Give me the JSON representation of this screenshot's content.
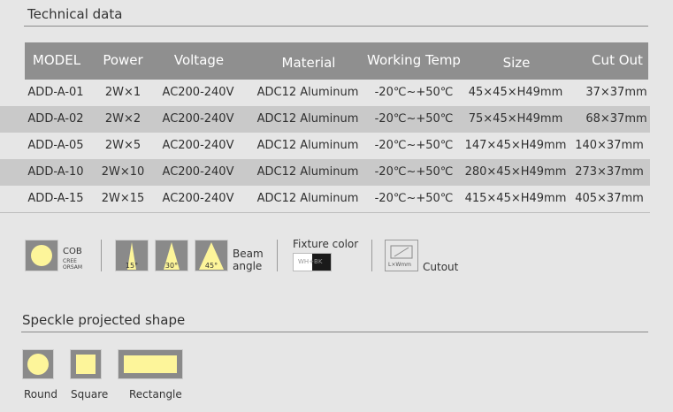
{
  "technical_title": "Technical data",
  "table": {
    "headers": [
      "MODEL",
      "Power",
      "Voltage",
      "Material",
      "Working Temp",
      "Size",
      "Cut Out"
    ],
    "rows": [
      [
        "ADD-A-01",
        "2W×1",
        "AC200-240V",
        "ADC12 Aluminum",
        "-20℃~+50℃",
        "45×45×H49mm",
        "37×37mm"
      ],
      [
        "ADD-A-02",
        "2W×2",
        "AC200-240V",
        "ADC12 Aluminum",
        "-20℃~+50℃",
        "75×45×H49mm",
        "68×37mm"
      ],
      [
        "ADD-A-05",
        "2W×5",
        "AC200-240V",
        "ADC12 Aluminum",
        "-20℃~+50℃",
        "147×45×H49mm",
        "140×37mm"
      ],
      [
        "ADD-A-10",
        "2W×10",
        "AC200-240V",
        "ADC12 Aluminum",
        "-20℃~+50℃",
        "280×45×H49mm",
        "273×37mm"
      ],
      [
        "ADD-A-15",
        "2W×15",
        "AC200-240V",
        "ADC12 Aluminum",
        "-20℃~+50℃",
        "415×45×H49mm",
        "405×37mm"
      ]
    ]
  },
  "features": {
    "cob": {
      "title": "COB",
      "sub1": "CREE",
      "sub2": "ORSAM"
    },
    "beam": {
      "angles": [
        "15°",
        "30°",
        "45°"
      ],
      "label_line1": "Beam",
      "label_line2": "angle"
    },
    "fixture": {
      "title": "Fixture color",
      "swatch_text": "WH+BK"
    },
    "cutout": {
      "icon_text": "L×Wmm",
      "label": "Cutout"
    }
  },
  "speckle": {
    "title": "Speckle projected shape",
    "shapes": [
      "Round",
      "Square",
      "Rectangle"
    ]
  },
  "colors": {
    "header_bg": "#8f8f8f",
    "row_shade": "#c9c9c9",
    "icon_bg": "#8a8a8a",
    "light_yellow": "#fdf59a"
  }
}
